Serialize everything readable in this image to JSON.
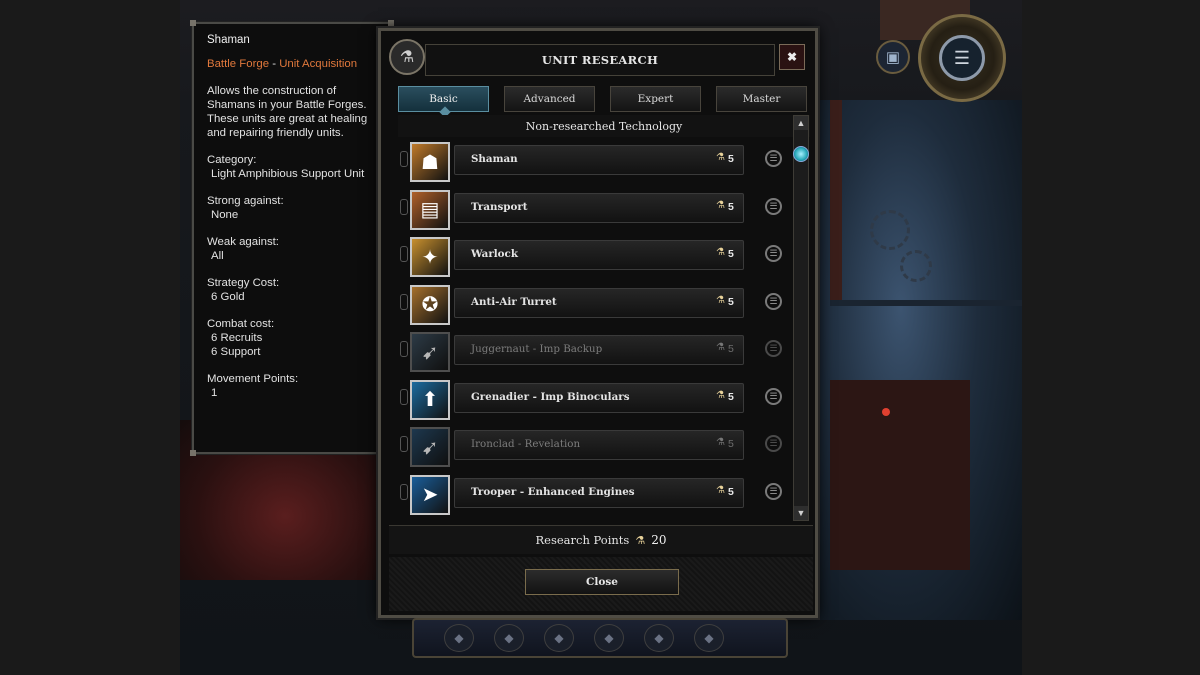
{
  "tooltip": {
    "title": "Shaman",
    "subtitle_part1": "Battle Forge",
    "subtitle_sep": " - ",
    "subtitle_part2": "Unit Acquisition",
    "description": "Allows the construction of Shamans in your Battle Forges. These units are great at healing and repairing friendly units.",
    "category_label": "Category:",
    "category_value": "Light Amphibious Support Unit",
    "strong_label": "Strong against:",
    "strong_value": "None",
    "weak_label": "Weak against:",
    "weak_value": "All",
    "strategy_label": "Strategy Cost:",
    "strategy_value": "6 Gold",
    "combat_label": "Combat cost:",
    "combat_value_1": "6 Recruits",
    "combat_value_2": "6 Support",
    "movement_label": "Movement Points:",
    "movement_value": "1"
  },
  "panel": {
    "title": "UNIT RESEARCH",
    "close_icon": "✖",
    "tabs": [
      {
        "label": "Basic",
        "active": true
      },
      {
        "label": "Advanced",
        "active": false
      },
      {
        "label": "Expert",
        "active": false
      },
      {
        "label": "Master",
        "active": false
      }
    ],
    "list_heading": "Non-researched Technology",
    "items": [
      {
        "name": "Shaman",
        "cost": "5",
        "locked": false,
        "icon": "shaman-icon",
        "color": "#c07a2a"
      },
      {
        "name": "Transport",
        "cost": "5",
        "locked": false,
        "icon": "transport-icon",
        "color": "#b0602a"
      },
      {
        "name": "Warlock",
        "cost": "5",
        "locked": false,
        "icon": "warlock-icon",
        "color": "#c8902e"
      },
      {
        "name": "Anti-Air Turret",
        "cost": "5",
        "locked": false,
        "icon": "turret-icon",
        "color": "#a6702c"
      },
      {
        "name": "Juggernaut - Imp Backup",
        "cost": "5",
        "locked": true,
        "icon": "juggernaut-icon",
        "color": "#3a4e5e"
      },
      {
        "name": "Grenadier - Imp Binoculars",
        "cost": "5",
        "locked": false,
        "icon": "grenadier-icon",
        "color": "#1c6ca0"
      },
      {
        "name": "Ironclad - Revelation",
        "cost": "5",
        "locked": true,
        "icon": "ironclad-icon",
        "color": "#244a6a"
      },
      {
        "name": "Trooper - Enhanced Engines",
        "cost": "5",
        "locked": false,
        "icon": "trooper-icon",
        "color": "#1a5e9a"
      }
    ],
    "research_label": "Research Points",
    "research_value": "20",
    "close_label": "Close"
  }
}
